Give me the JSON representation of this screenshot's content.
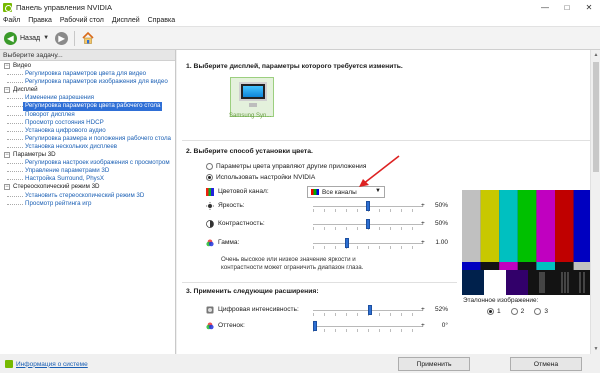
{
  "window": {
    "title": "Панель управления NVIDIA",
    "controls": [
      "—",
      "□",
      "✕"
    ]
  },
  "menu": [
    "Файл",
    "Правка",
    "Рабочий стол",
    "Дисплей",
    "Справка"
  ],
  "toolbar": {
    "back_label": "Назад",
    "back_symbol": "◀",
    "forward_symbol": "▶",
    "dropdown_symbol": "▼"
  },
  "left": {
    "task_header": "Выберите задачу...",
    "tree": [
      {
        "type": "cat",
        "label": "Видео",
        "expander": "−"
      },
      {
        "type": "item",
        "label": "Регулировка параметров цвета для видео"
      },
      {
        "type": "item",
        "label": "Регулировка параметров изображения для видео"
      },
      {
        "type": "cat",
        "label": "Дисплей",
        "expander": "−"
      },
      {
        "type": "item",
        "label": "Изменение разрешения"
      },
      {
        "type": "item",
        "label": "Регулировка параметров цвета рабочего стола",
        "selected": true
      },
      {
        "type": "item",
        "label": "Поворот дисплея"
      },
      {
        "type": "item",
        "label": "Просмотр состояния HDCP"
      },
      {
        "type": "item",
        "label": "Установка цифрового аудио"
      },
      {
        "type": "item",
        "label": "Регулировка размера и положения рабочего стола"
      },
      {
        "type": "item",
        "label": "Установка нескольких дисплеев"
      },
      {
        "type": "cat",
        "label": "Параметры 3D",
        "expander": "−"
      },
      {
        "type": "item",
        "label": "Регулировка настроек изображения с просмотром"
      },
      {
        "type": "item",
        "label": "Управление параметрами 3D"
      },
      {
        "type": "item",
        "label": "Настройка Surround, PhysX"
      },
      {
        "type": "cat",
        "label": "Стереоскопический режим 3D",
        "expander": "−"
      },
      {
        "type": "item",
        "label": "Установить стереоскопический режим 3D"
      },
      {
        "type": "item",
        "label": "Просмотр рейтинга игр"
      }
    ],
    "info_link": "Информация о системе"
  },
  "right": {
    "section1": {
      "title": "1. Выберите дисплей, параметры которого требуется изменить.",
      "display_label": "Samsung Syn..."
    },
    "section2": {
      "title": "2. Выберите способ установки цвета.",
      "radio_other": "Параметры цвета управляют другие приложения",
      "radio_nvidia": "Использовать настройки NVIDIA",
      "channel_label": "Цветовой канал:",
      "channel_value": "Все каналы",
      "sliders": [
        {
          "label": "Яркость:",
          "sign": "+",
          "value": "50%",
          "position": 0.5
        },
        {
          "label": "Контрастность:",
          "sign": "+",
          "value": "50%",
          "position": 0.5
        },
        {
          "label": "Гамма:",
          "sign": "+",
          "value": "1.00",
          "position": 0.3
        }
      ],
      "warning": "Очень высокое или низкое значение яркости и контрастности может ограничить диапазон глаза."
    },
    "section3": {
      "title": "3. Применить следующие расширения:",
      "sliders": [
        {
          "label": "Цифровая интенсивность:",
          "sign": "+",
          "value": "52%",
          "position": 0.52
        },
        {
          "label": "Оттенок:",
          "sign": "+",
          "value": "0°",
          "position": 0.0
        }
      ]
    },
    "reference": {
      "label": "Эталонное изображение:",
      "options": [
        "1",
        "2",
        "3"
      ],
      "selected": "1"
    }
  },
  "buttons": {
    "apply": "Применить",
    "cancel": "Отмена"
  },
  "colors": {
    "nvidia_green": "#76b900",
    "selection_blue": "#2f6fd6",
    "link_blue": "#1a5fb4",
    "slider_blue": "#2d6fd2"
  }
}
